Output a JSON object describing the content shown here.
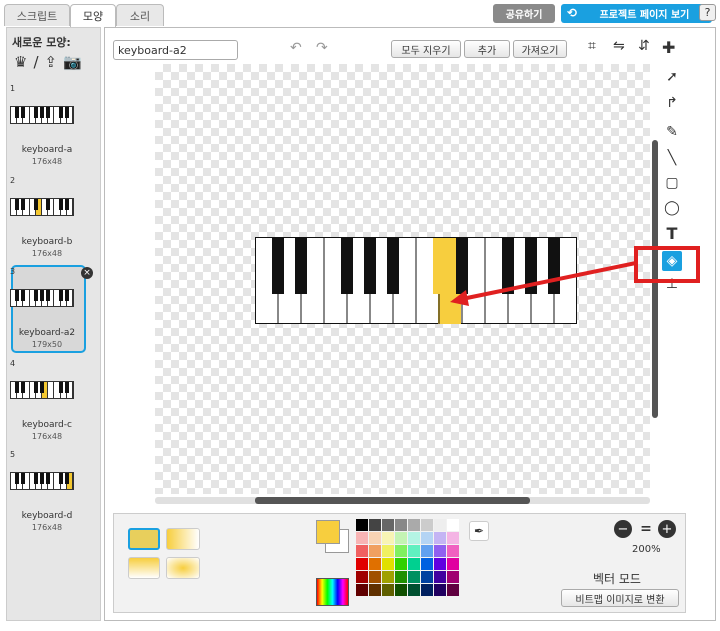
{
  "tabs": [
    {
      "label": "스크립트"
    },
    {
      "label": "모양"
    },
    {
      "label": "소리"
    }
  ],
  "top_buttons": {
    "share": "공유하기",
    "project_page": "프로젝트 페이지 보기"
  },
  "sidebar": {
    "new_costume_label": "새로운 모양:",
    "costumes": [
      {
        "num": "1",
        "name": "keyboard-a",
        "size": "176x48"
      },
      {
        "num": "2",
        "name": "keyboard-b",
        "size": "176x48"
      },
      {
        "num": "3",
        "name": "keyboard-a2",
        "size": "179x50"
      },
      {
        "num": "4",
        "name": "keyboard-c",
        "size": "176x48"
      },
      {
        "num": "5",
        "name": "keyboard-d",
        "size": "176x48"
      }
    ]
  },
  "editor": {
    "costume_name_value": "keyboard-a2",
    "clear_label": "모두 지우기",
    "add_label": "추가",
    "import_label": "가져오기",
    "zoom_level": "200%",
    "mode_label": "벡터 모드",
    "convert_label": "비트맵 이미지로 변환"
  },
  "colors": {
    "selected_fill": "#f7ce3e",
    "highlight": "#e02020",
    "accent_blue": "#1aa0e0"
  },
  "help_icon_label": "?"
}
